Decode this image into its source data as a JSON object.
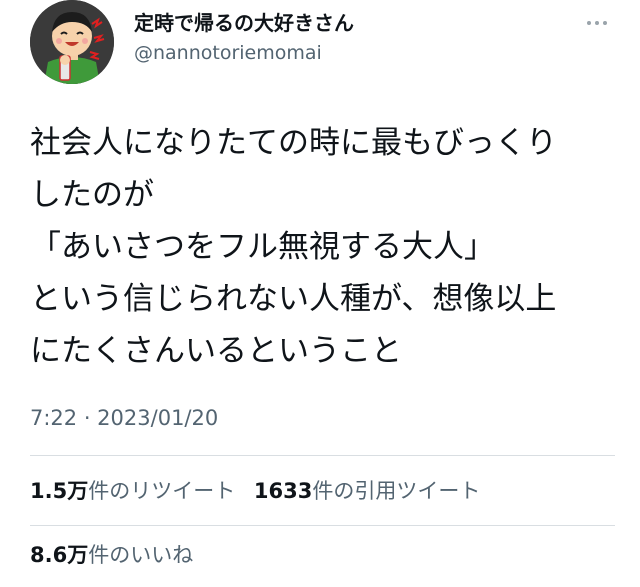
{
  "author": {
    "display_name": "定時で帰るの大好きさん",
    "handle": "@nannotoriemomai",
    "avatar_icon": "avatar-illustration-icon"
  },
  "more_menu": {
    "icon": "more-dots-icon"
  },
  "tweet": {
    "lines": [
      "社会人になりたての時に最もびっくり",
      "したのが",
      "「あいさつをフル無視する大人」",
      "という信じられない人種が、想像以上",
      "にたくさんいるということ"
    ],
    "timestamp": "7:22 · 2023/01/20"
  },
  "stats": {
    "retweets": {
      "count": "1.5万",
      "label": "件のリツイート"
    },
    "quotes": {
      "count": "1633",
      "label": "件の引用ツイート"
    },
    "likes": {
      "count": "8.6万",
      "label": "件のいいね"
    }
  },
  "colors": {
    "text_primary": "#0f1419",
    "text_secondary": "#536471",
    "divider": "#d9dee2"
  }
}
